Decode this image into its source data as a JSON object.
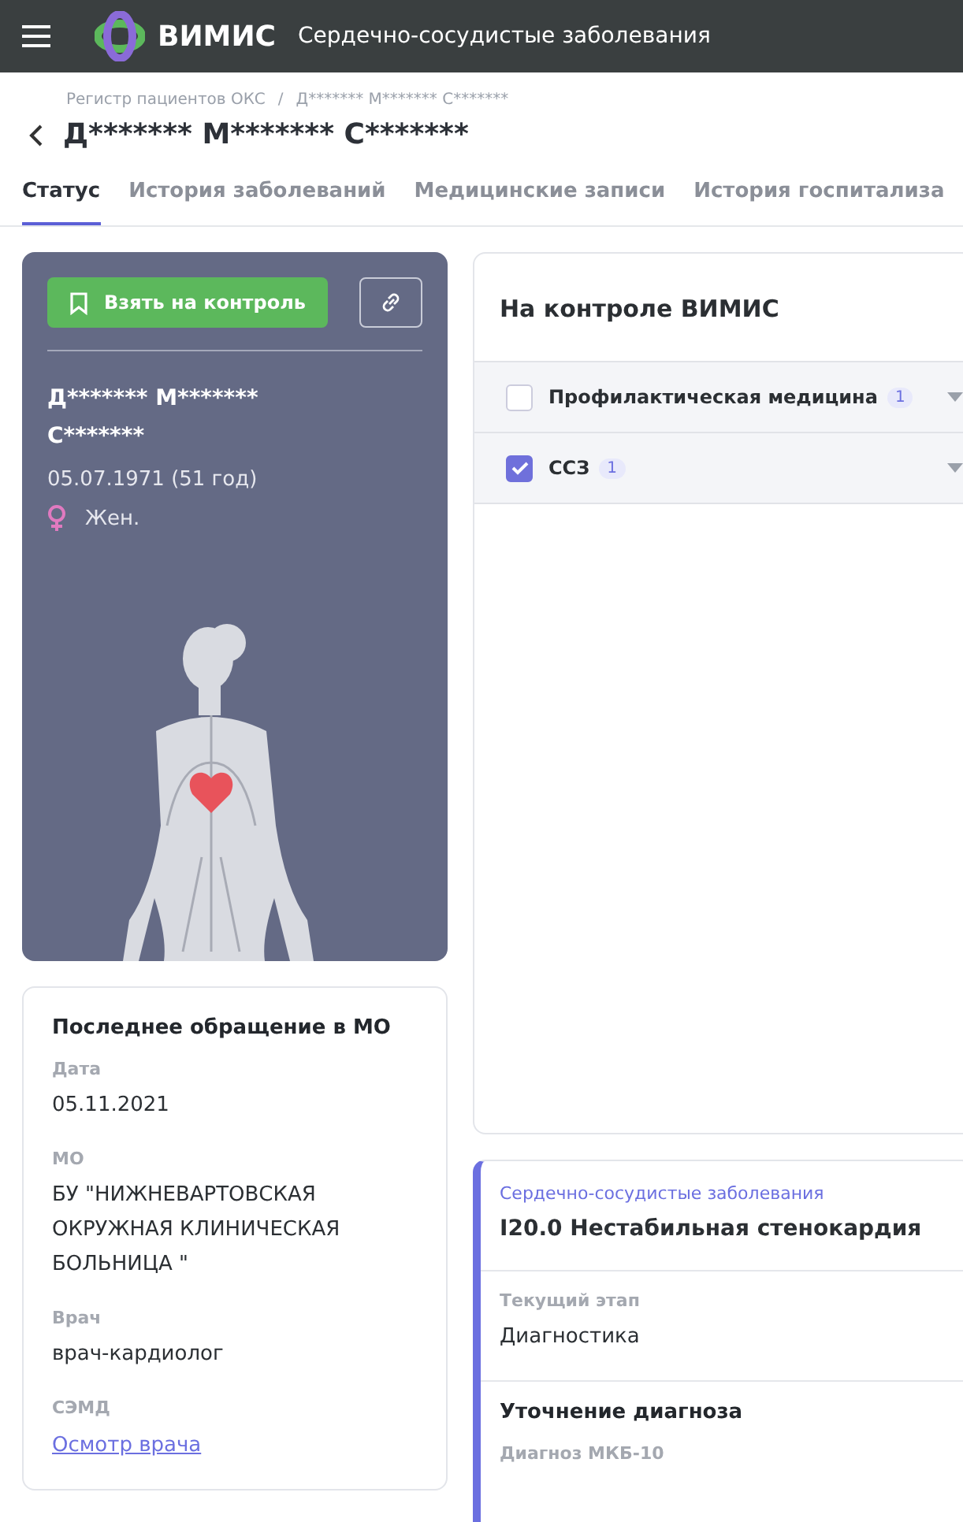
{
  "header": {
    "brand": "ВИМИС",
    "title": "Сердечно-сосудистые заболевания"
  },
  "breadcrumbs": [
    "Регистр пациентов ОКС",
    "/",
    "Д******* М******* С*******"
  ],
  "page_title": "Д******* М******* С*******",
  "tabs": [
    {
      "label": "Статус",
      "selected": true
    },
    {
      "label": "История заболеваний",
      "selected": false
    },
    {
      "label": "Медицинские записи",
      "selected": false
    },
    {
      "label": "История госпитализа",
      "selected": false
    }
  ],
  "patient": {
    "control_button": "Взять на контроль",
    "name": "Д******* М******* С*******",
    "birth": "05.07.1971 (51 год)",
    "sex": "Жен."
  },
  "control": {
    "title": "На контроле ВИМИС",
    "items": [
      {
        "label": "Профилактическая медицина",
        "count": "1",
        "checked": false
      },
      {
        "label": "ССЗ",
        "count": "1",
        "checked": true
      }
    ]
  },
  "last_visit": {
    "title": "Последнее обращение в МО",
    "fields": [
      {
        "label": "Дата",
        "value": "05.11.2021",
        "kind": "text"
      },
      {
        "label": "МО",
        "value": "БУ \"НИЖНЕВАРТОВСКАЯ ОКРУЖНАЯ КЛИНИЧЕСКАЯ БОЛЬНИЦА \"",
        "kind": "text"
      },
      {
        "label": "Врач",
        "value": "врач-кардиолог",
        "kind": "text"
      },
      {
        "label": "СЭМД",
        "value": "Осмотр врача",
        "kind": "link"
      }
    ]
  },
  "diagnosis": {
    "category": "Сердечно-сосудистые заболевания",
    "title": "I20.0 Нестабильная стенокардия",
    "stage_label": "Текущий этап",
    "stage": "Диагностика",
    "section": "Уточнение диагноза",
    "field_label": "Диагноз МКБ-10"
  }
}
